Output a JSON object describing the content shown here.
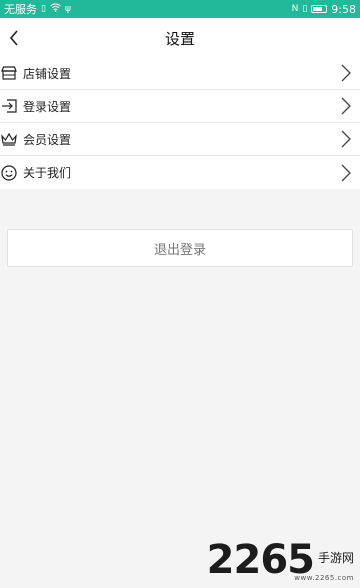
{
  "status_bar": {
    "carrier": "无服务",
    "time": "9:58"
  },
  "nav": {
    "title": "设置"
  },
  "menu": [
    {
      "icon": "store-icon",
      "label": "店铺设置"
    },
    {
      "icon": "login-icon",
      "label": "登录设置"
    },
    {
      "icon": "crown-icon",
      "label": "会员设置"
    },
    {
      "icon": "smile-icon",
      "label": "关于我们"
    }
  ],
  "logout": {
    "label": "退出登录"
  },
  "watermark": {
    "number": "2265",
    "text": "手游网",
    "url": "www.2265.com"
  },
  "colors": {
    "status_bar": "#21b99a",
    "background": "#f4f4f4"
  }
}
